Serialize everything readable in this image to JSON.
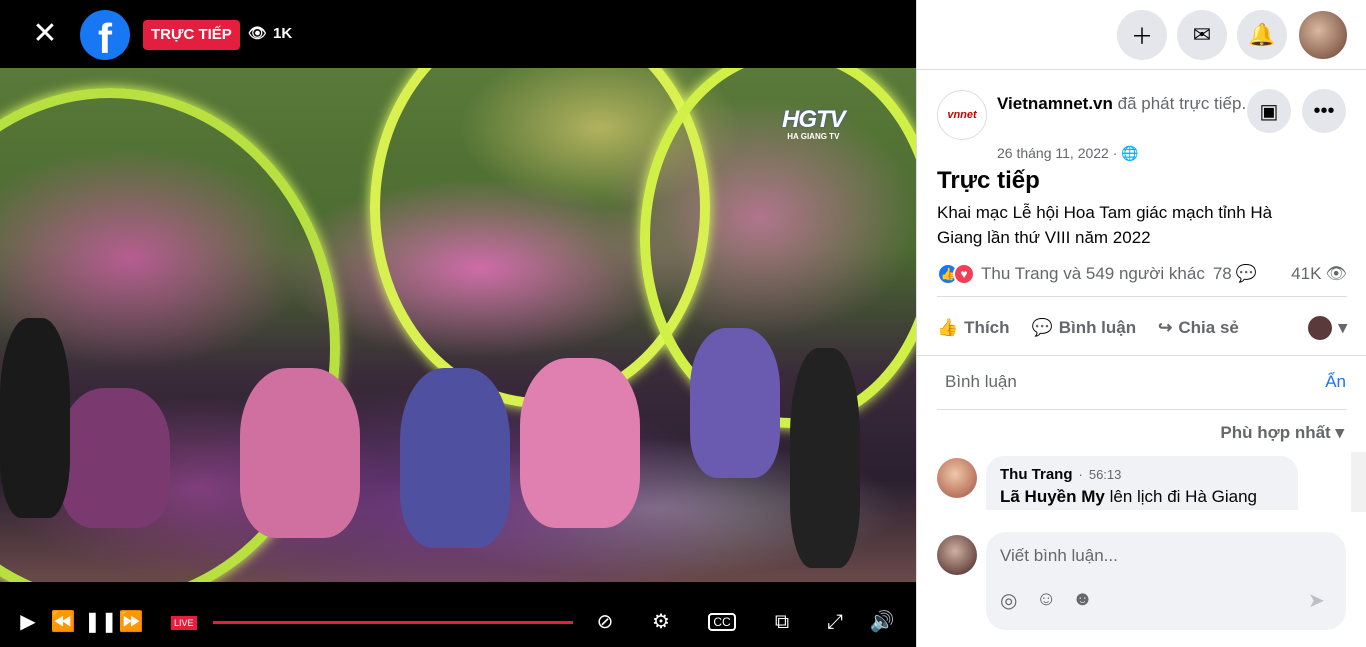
{
  "topbar": {
    "close_icon": "close-icon",
    "live_label": "TRỰC TIẾP",
    "viewer_count": "1K"
  },
  "video": {
    "watermark_logo": "HGTV",
    "watermark_sub": "HA GIANG TV"
  },
  "controls": {
    "live_tag": "LIVE"
  },
  "post": {
    "page_name": "Vietnamnet.vn",
    "action_text": "đã phát trực tiếp.",
    "date": "26 tháng 11, 2022 ·",
    "title": "Trực tiếp",
    "description": "Khai mạc Lễ hội Hoa Tam giác mạch tỉnh Hà Giang lần thứ VIII năm 2022",
    "reactors": "Thu Trang và 549 người khác",
    "comment_count": "78",
    "view_count": "41K",
    "actions": {
      "like": "Thích",
      "comment": "Bình luận",
      "share": "Chia sẻ"
    }
  },
  "comments": {
    "header": "Bình luận",
    "hide": "Ẩn",
    "sort": "Phù hợp nhất",
    "items": [
      {
        "name": "Thu Trang",
        "time": "56:13",
        "mention": "Lã Huyền My",
        "text": " lên lịch đi Hà Giang"
      }
    ],
    "input_placeholder": "Viết bình luận..."
  },
  "colors": {
    "accent": "#1877f2",
    "live_red": "#e41e3f"
  }
}
